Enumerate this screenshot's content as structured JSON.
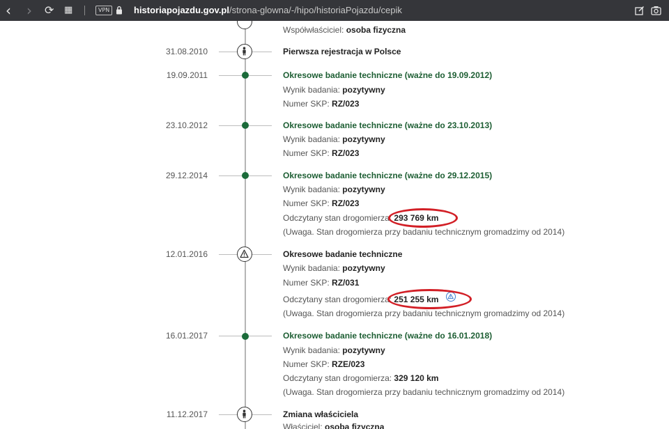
{
  "browser": {
    "back": "‹",
    "forward": "›",
    "reload": "⟳",
    "grid": "▦",
    "vpn": "VPN",
    "url_host": "historiapojazdu.gov.pl",
    "url_path": "/strona-glowna/-/hipo/historiaPojazdu/cepik"
  },
  "timeline": {
    "coowner": {
      "label": "Współwłaściciel:",
      "value": "osoba fizyczna"
    },
    "e1": {
      "date": "31.08.2010",
      "title": "Pierwsza rejestracja w Polsce"
    },
    "e2": {
      "date": "19.09.2011",
      "title": "Okresowe badanie techniczne (ważne do 19.09.2012)",
      "result_label": "Wynik badania:",
      "result": "pozytywny",
      "skp_label": "Numer SKP:",
      "skp": "RZ/023"
    },
    "e3": {
      "date": "23.10.2012",
      "title": "Okresowe badanie techniczne (ważne do 23.10.2013)",
      "result_label": "Wynik badania:",
      "result": "pozytywny",
      "skp_label": "Numer SKP:",
      "skp": "RZ/023"
    },
    "e4": {
      "date": "29.12.2014",
      "title": "Okresowe badanie techniczne (ważne do 29.12.2015)",
      "result_label": "Wynik badania:",
      "result": "pozytywny",
      "skp_label": "Numer SKP:",
      "skp": "RZ/023",
      "odo_label": "Odczytany stan drogomierza:",
      "odo": "293 769 km",
      "note": "(Uwaga. Stan drogomierza przy badaniu technicznym gromadzimy od 2014)"
    },
    "e5": {
      "date": "12.01.2016",
      "title": "Okresowe badanie techniczne",
      "result_label": "Wynik badania:",
      "result": "pozytywny",
      "skp_label": "Numer SKP:",
      "skp": "RZ/031",
      "odo_label": "Odczytany stan drogomierza:",
      "odo": "251 255 km",
      "note": "(Uwaga. Stan drogomierza przy badaniu technicznym gromadzimy od 2014)"
    },
    "e6": {
      "date": "16.01.2017",
      "title": "Okresowe badanie techniczne (ważne do 16.01.2018)",
      "result_label": "Wynik badania:",
      "result": "pozytywny",
      "skp_label": "Numer SKP:",
      "skp": "RZE/023",
      "odo_label": "Odczytany stan drogomierza:",
      "odo": "329 120 km",
      "note": "(Uwaga. Stan drogomierza przy badaniu technicznym gromadzimy od 2014)"
    },
    "e7": {
      "date": "11.12.2017",
      "title": "Zmiana właściciela",
      "owner_label": "Właściciel:",
      "owner": "osoba fizyczna"
    }
  },
  "colors": {
    "accent_green": "#1d5e33",
    "highlight_red": "#d21f26",
    "warning_blue": "#3f7fd0"
  }
}
